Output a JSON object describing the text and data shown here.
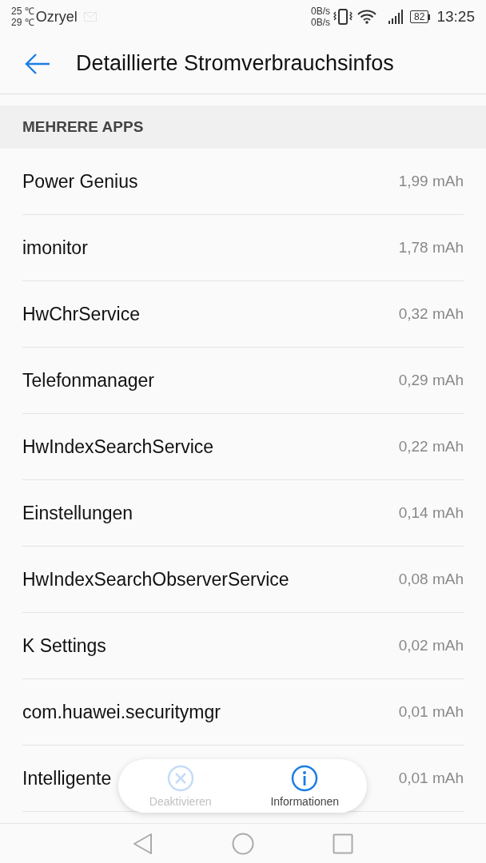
{
  "status_bar": {
    "temp_high": "25 ℃",
    "temp_low": "29 ℃",
    "carrier": "Ozryel",
    "speed_up": "0B/s",
    "speed_down": "0B/s",
    "battery": "82",
    "time": "13:25"
  },
  "header": {
    "title": "Detaillierte Stromverbrauchsinfos"
  },
  "section": {
    "title": "MEHRERE APPS"
  },
  "rows": [
    {
      "name": "Power Genius",
      "value": "1,99 mAh"
    },
    {
      "name": "imonitor",
      "value": "1,78 mAh"
    },
    {
      "name": "HwChrService",
      "value": "0,32 mAh"
    },
    {
      "name": "Telefonmanager",
      "value": "0,29 mAh"
    },
    {
      "name": "HwIndexSearchService",
      "value": "0,22 mAh"
    },
    {
      "name": "Einstellungen",
      "value": "0,14 mAh"
    },
    {
      "name": "HwIndexSearchObserverService",
      "value": "0,08 mAh"
    },
    {
      "name": "K Settings",
      "value": "0,02 mAh"
    },
    {
      "name": "com.huawei.securitymgr",
      "value": "0,01 mAh"
    },
    {
      "name": "Intelligente",
      "value": "0,01 mAh"
    }
  ],
  "actions": [
    {
      "kind": "close",
      "label": "Deaktivieren",
      "disabled": true
    },
    {
      "kind": "info",
      "label": "Informationen",
      "disabled": false
    }
  ]
}
